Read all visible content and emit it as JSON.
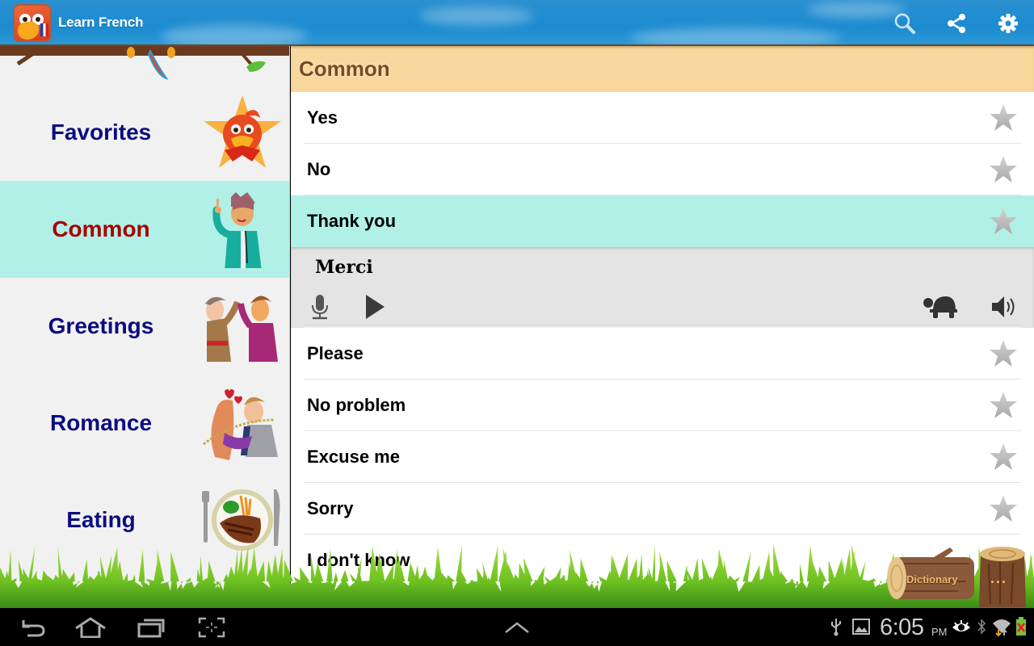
{
  "app": {
    "title": "Learn French",
    "actions": [
      {
        "name": "search",
        "icon": "search-icon"
      },
      {
        "name": "share",
        "icon": "share-icon"
      },
      {
        "name": "settings",
        "icon": "gear-icon"
      }
    ]
  },
  "sidebar": {
    "categories": [
      {
        "label": "Favorites",
        "icon": "parrot-star-icon",
        "active": false
      },
      {
        "label": "Common",
        "icon": "man-pointing-icon",
        "active": true
      },
      {
        "label": "Greetings",
        "icon": "high-five-icon",
        "active": false
      },
      {
        "label": "Romance",
        "icon": "couple-kissing-icon",
        "active": false
      },
      {
        "label": "Eating",
        "icon": "plate-steak-icon",
        "active": false
      }
    ]
  },
  "main": {
    "section_title": "Common",
    "phrases": [
      {
        "label": "Yes",
        "favorite": false
      },
      {
        "label": "No",
        "favorite": false
      },
      {
        "label": "Thank you",
        "favorite": false,
        "selected": true
      },
      {
        "label": "Please",
        "favorite": false
      },
      {
        "label": "No problem",
        "favorite": false
      },
      {
        "label": "Excuse me",
        "favorite": false
      },
      {
        "label": "Sorry",
        "favorite": false
      },
      {
        "label": "I don't know",
        "favorite": false
      }
    ],
    "expanded": {
      "translation": "Merci",
      "controls": {
        "record": "microphone-icon",
        "play": "play-icon",
        "slow": "turtle-icon",
        "speak": "speaker-icon"
      }
    }
  },
  "bottom_buttons": {
    "dictionary_label": "Dictionary",
    "more_label": "..."
  },
  "system_bar": {
    "nav": [
      "back-icon",
      "home-icon",
      "recent-apps-icon",
      "screenshot-icon"
    ],
    "up_arrow": "chevron-up-icon",
    "time": "6:05",
    "ampm": "PM",
    "status_icons": [
      "usb-icon",
      "gallery-icon",
      "eye-icon",
      "bluetooth-icon",
      "wifi-icon",
      "battery-icon"
    ]
  },
  "colors": {
    "actionbar": "#1c8bd0",
    "selected_bg": "#b0f0e6",
    "category_text": "#0c0c80",
    "category_active_text": "#a80000",
    "section_header_bg": "#f8d89c",
    "section_header_text": "#7a4a28"
  }
}
